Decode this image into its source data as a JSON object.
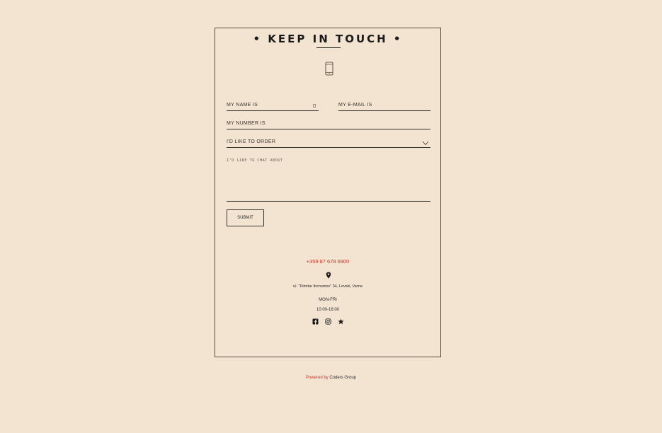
{
  "contact": {
    "title": "• KEEP IN TOUCH •",
    "form": {
      "name_placeholder": "MY NAME IS",
      "email_placeholder": "MY E-MAIL IS",
      "number_placeholder": "MY NUMBER IS",
      "order_placeholder": "I'D LIKE TO ORDER",
      "chat_placeholder": "I'D LIKE TO CHAT ABOUT",
      "submit_label": "SUBMIT"
    },
    "info": {
      "phone": "+359 87 678 6900",
      "address": "ul. \"Dimitar Ikonomov\" 34, Levski, Varna",
      "days": "MON-FRI",
      "hours": "10:00-16:00"
    },
    "social": [
      "facebook-icon",
      "instagram-icon",
      "star-icon"
    ]
  },
  "footer": {
    "powered_by": "Powered by",
    "company": "Coders Group"
  },
  "colors": {
    "background": "#f3e4d1",
    "accent": "#c4392b",
    "text": "#2b2b2b"
  }
}
